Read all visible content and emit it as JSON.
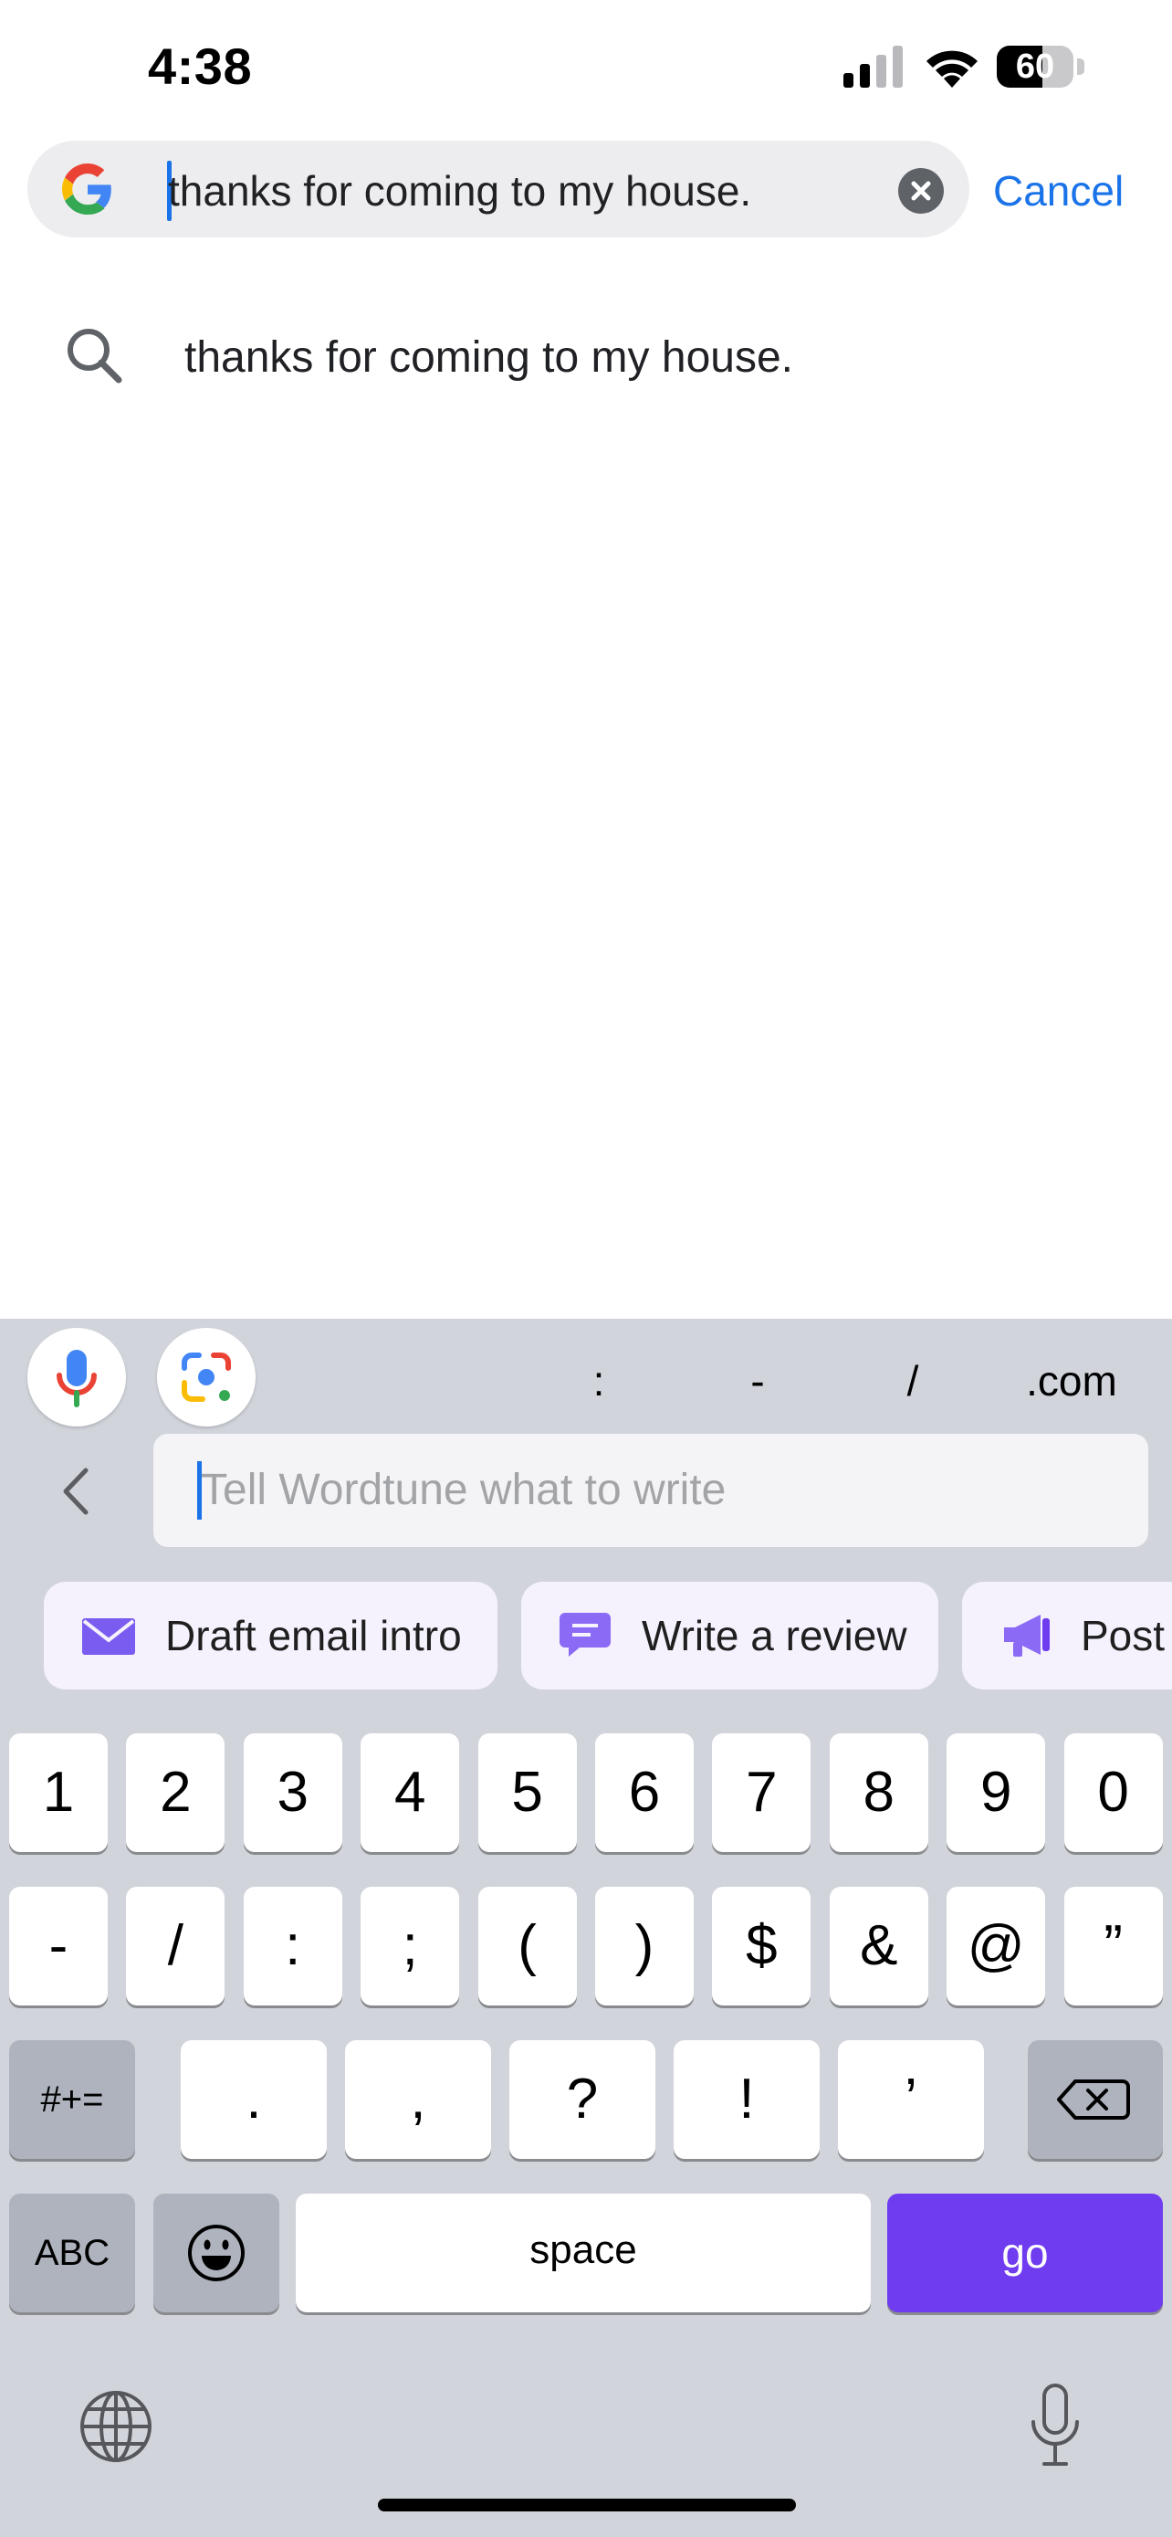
{
  "status_bar": {
    "time": "4:38",
    "battery": "60",
    "battery_level": 0.6
  },
  "search": {
    "query": "thanks for coming to my house.",
    "cancel_label": "Cancel"
  },
  "suggestions": [
    {
      "text": "thanks for coming to my house."
    }
  ],
  "keyboard": {
    "accessory_keys": [
      ":",
      "-",
      "/",
      ".com"
    ],
    "wordtune_placeholder": "Tell Wordtune what to write",
    "chips": [
      {
        "label": "Draft email intro",
        "icon": "envelope-icon"
      },
      {
        "label": "Write a review",
        "icon": "chat-bubble-icon"
      },
      {
        "label": "Post",
        "icon": "megaphone-icon"
      }
    ],
    "row1": [
      "1",
      "2",
      "3",
      "4",
      "5",
      "6",
      "7",
      "8",
      "9",
      "0"
    ],
    "row2": [
      "-",
      "/",
      ":",
      ";",
      "(",
      ")",
      "$",
      "&",
      "@",
      "”"
    ],
    "row3_left": "#+=",
    "row3_mid": [
      ".",
      ",",
      "?",
      "!",
      "’"
    ],
    "abc_label": "ABC",
    "space_label": "space",
    "go_label": "go"
  },
  "colors": {
    "accent": "#1a73e8",
    "go_key": "#6f3cf0",
    "keyboard_bg": "#d1d4db",
    "chip_bg": "#f5f2fd"
  }
}
